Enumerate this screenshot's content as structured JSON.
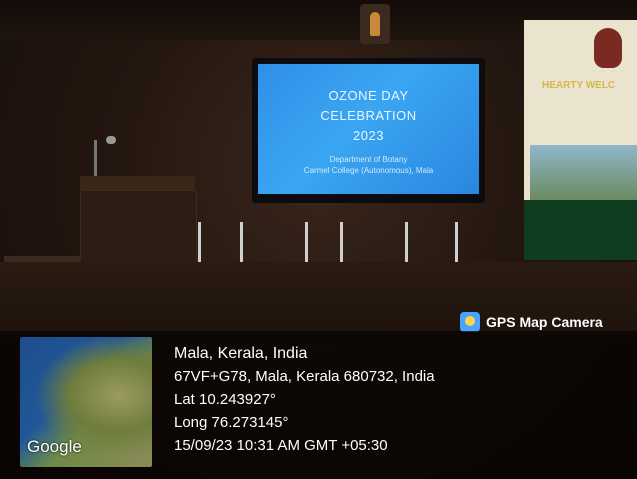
{
  "screen": {
    "line1": "OZONE DAY",
    "line2": "CELEBRATION",
    "line3": "2023",
    "sub1": "Department of Botany",
    "sub2": "Carmel College (Autonomous), Mala"
  },
  "banner": {
    "text": "HEARTY WELC"
  },
  "overlay": {
    "brand": "GPS Map Camera",
    "map_label": "Google",
    "location": "Mala, Kerala, India",
    "address": "67VF+G78, Mala, Kerala 680732, India",
    "lat": "Lat 10.243927°",
    "long": "Long 76.273145°",
    "datetime": "15/09/23 10:31 AM GMT +05:30"
  },
  "icons": {
    "gps_app": "gps-map-camera-icon"
  }
}
